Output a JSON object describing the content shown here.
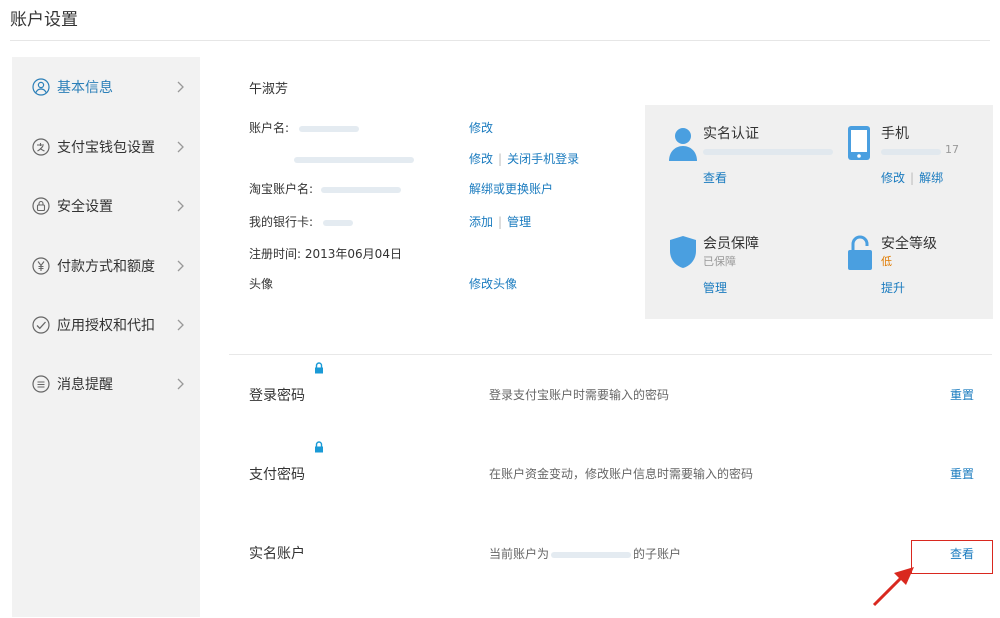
{
  "page": {
    "title": "账户设置"
  },
  "sidebar": {
    "items": [
      {
        "label": "基本信息",
        "icon": "user-circle-icon",
        "active": true
      },
      {
        "label": "支付宝钱包设置",
        "icon": "wallet-icon"
      },
      {
        "label": "安全设置",
        "icon": "lock-circle-icon"
      },
      {
        "label": "付款方式和额度",
        "icon": "yuan-circle-icon"
      },
      {
        "label": "应用授权和代扣",
        "icon": "check-circle-icon"
      },
      {
        "label": "消息提醒",
        "icon": "message-circle-icon"
      }
    ]
  },
  "basic": {
    "name": "午淑芳",
    "account_label": "账户名:",
    "account_action": "修改",
    "phone_actions": [
      "修改",
      "关闭手机登录"
    ],
    "taobao_label": "淘宝账户名:",
    "taobao_action": "解绑或更换账户",
    "bank_label": "我的银行卡:",
    "bank_actions": [
      "添加",
      "管理"
    ],
    "register_label": "注册时间:",
    "register_value": "2013年06月04日",
    "avatar_label": "头像",
    "avatar_action": "修改头像"
  },
  "security_card": {
    "realname": {
      "title": "实名认证",
      "link": "查看",
      "icon": "person-icon"
    },
    "phone": {
      "title": "手机",
      "links": [
        "修改",
        "解绑"
      ],
      "tail": "17",
      "icon": "mobile-phone-icon"
    },
    "guarantee": {
      "title": "会员保障",
      "status": "已保障",
      "link": "管理",
      "icon": "shield-icon"
    },
    "level": {
      "title": "安全等级",
      "value": "低",
      "value_color": "#e07b00",
      "link": "提升",
      "icon": "unlocked-padlock-icon"
    }
  },
  "passwords": [
    {
      "label": "登录密码",
      "desc": "登录支付宝账户时需要输入的密码",
      "action": "重置"
    },
    {
      "label": "支付密码",
      "desc": "在账户资金变动，修改账户信息时需要输入的密码",
      "action": "重置"
    }
  ],
  "realname_account": {
    "label": "实名账户",
    "desc_prefix": "当前账户为",
    "desc_suffix": "的子账户",
    "action": "查看"
  },
  "colors": {
    "link": "#1a7bbf",
    "accent": "#4a9fe0",
    "highlight": "#d9281f"
  }
}
